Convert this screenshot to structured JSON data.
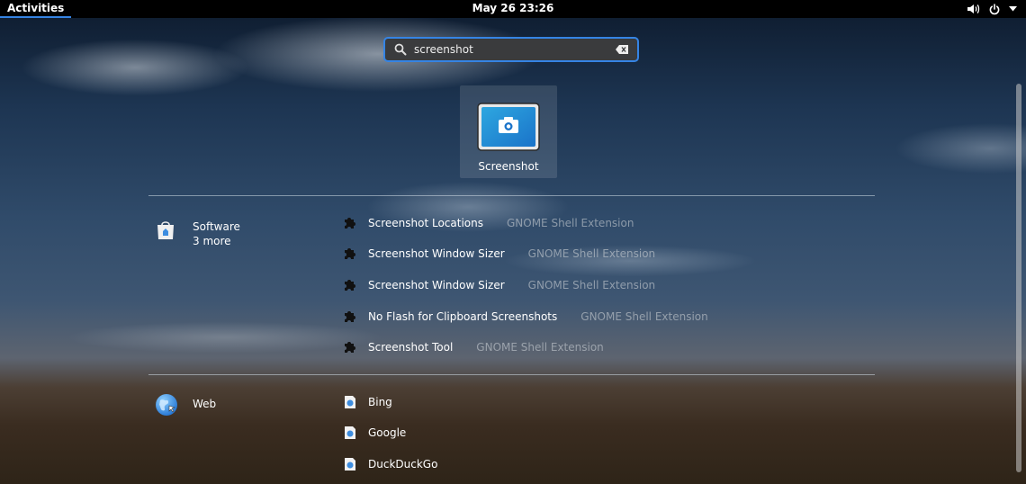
{
  "topbar": {
    "activities_label": "Activities",
    "clock": "May 26  23:26",
    "status_icons": [
      "volume-icon",
      "power-icon",
      "menu-arrow-icon"
    ]
  },
  "search": {
    "value": "screenshot",
    "icon": "search-icon",
    "clear_icon": "clear-text-icon"
  },
  "app_result": {
    "label": "Screenshot",
    "icon": "screenshot-camera-icon"
  },
  "providers": [
    {
      "name": "Software",
      "more": "3 more",
      "icon": "software-bag-icon",
      "results": [
        {
          "title": "Screenshot Locations",
          "desc": "GNOME Shell Extension"
        },
        {
          "title": "Screenshot Window Sizer",
          "desc": "GNOME Shell Extension"
        },
        {
          "title": "Screenshot Window Sizer",
          "desc": "GNOME Shell Extension"
        },
        {
          "title": "No Flash for Clipboard Screenshots",
          "desc": "GNOME Shell Extension"
        },
        {
          "title": "Screenshot Tool",
          "desc": "GNOME Shell Extension"
        }
      ]
    },
    {
      "name": "Web",
      "icon": "web-globe-icon",
      "results": [
        {
          "title": "Bing"
        },
        {
          "title": "Google"
        },
        {
          "title": "DuckDuckGo"
        }
      ]
    }
  ],
  "colors": {
    "accent": "#3584e4",
    "topbar": "#000000",
    "search_bg": "#3a3b3d"
  }
}
